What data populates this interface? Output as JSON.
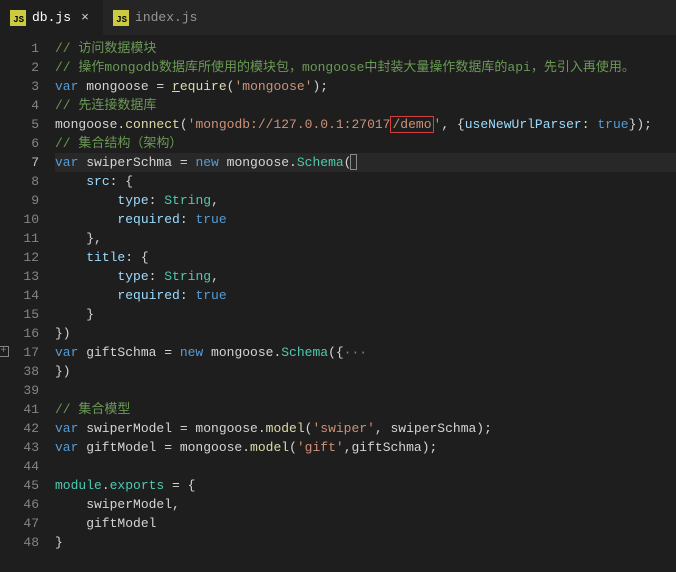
{
  "tabs": [
    {
      "icon": "JS",
      "label": "db.js",
      "active": true,
      "close": "×"
    },
    {
      "icon": "JS",
      "label": "index.js",
      "active": false
    }
  ],
  "gutter": [
    "1",
    "2",
    "3",
    "4",
    "5",
    "6",
    "7",
    "8",
    "9",
    "10",
    "11",
    "12",
    "13",
    "14",
    "15",
    "16",
    "17",
    "38",
    "39",
    "41",
    "42",
    "43",
    "44",
    "45",
    "46",
    "47",
    "48"
  ],
  "activeLine": "7",
  "foldLine": "17",
  "code": {
    "l1": "// 访问数据模块",
    "l2": "// 操作mongodb数据库所使用的模块包，mongoose中封装大量操作数据库的api，先引入再使用。",
    "l3a": "var",
    "l3b": " mongoose = ",
    "l3c": "r",
    "l3d": "equire",
    "l3e": "(",
    "l3f": "'mongoose'",
    "l3g": ");",
    "l4": "// 先连接数据库",
    "l5a": "mongoose.",
    "l5b": "connect",
    "l5c": "(",
    "l5d1": "'mongodb://127.0.0.1:27017",
    "l5d2": "/demo",
    "l5d3": "'",
    "l5e": ", {",
    "l5f": "useNewUrlParser",
    "l5g": ": ",
    "l5h": "true",
    "l5i": "});",
    "l6": "// 集合结构（架构）",
    "l7a": "var",
    "l7b": " swiperSchma = ",
    "l7c": "new",
    "l7d": " mongoose.",
    "l7e": "Schema",
    "l7f": "(",
    "l8a": "    ",
    "l8b": "src",
    "l8c": ": {",
    "l9a": "        ",
    "l9b": "type",
    "l9c": ": ",
    "l9d": "String",
    "l9e": ",",
    "l10a": "        ",
    "l10b": "required",
    "l10c": ": ",
    "l10d": "true",
    "l11": "    },",
    "l12a": "    ",
    "l12b": "title",
    "l12c": ": {",
    "l13a": "        ",
    "l13b": "type",
    "l13c": ": ",
    "l13d": "String",
    "l13e": ",",
    "l14a": "        ",
    "l14b": "required",
    "l14c": ": ",
    "l14d": "true",
    "l15": "    }",
    "l16": "})",
    "l17a": "var",
    "l17b": " giftSchma = ",
    "l17c": "new",
    "l17d": " mongoose.",
    "l17e": "Schema",
    "l17f": "({",
    "l17g": "···",
    "l38": "})",
    "l41": "// 集合模型",
    "l42a": "var",
    "l42b": " swiperModel = mongoose.",
    "l42c": "model",
    "l42d": "(",
    "l42e": "'swiper'",
    "l42f": ", swiperSchma);",
    "l43a": "var",
    "l43b": " giftModel = mongoose.",
    "l43c": "model",
    "l43d": "(",
    "l43e": "'gift'",
    "l43f": ",giftSchma);",
    "l45a": "module",
    "l45b": ".",
    "l45c": "exports",
    "l45d": " = {",
    "l46": "    swiperModel,",
    "l47": "    giftModel",
    "l48": "}"
  }
}
